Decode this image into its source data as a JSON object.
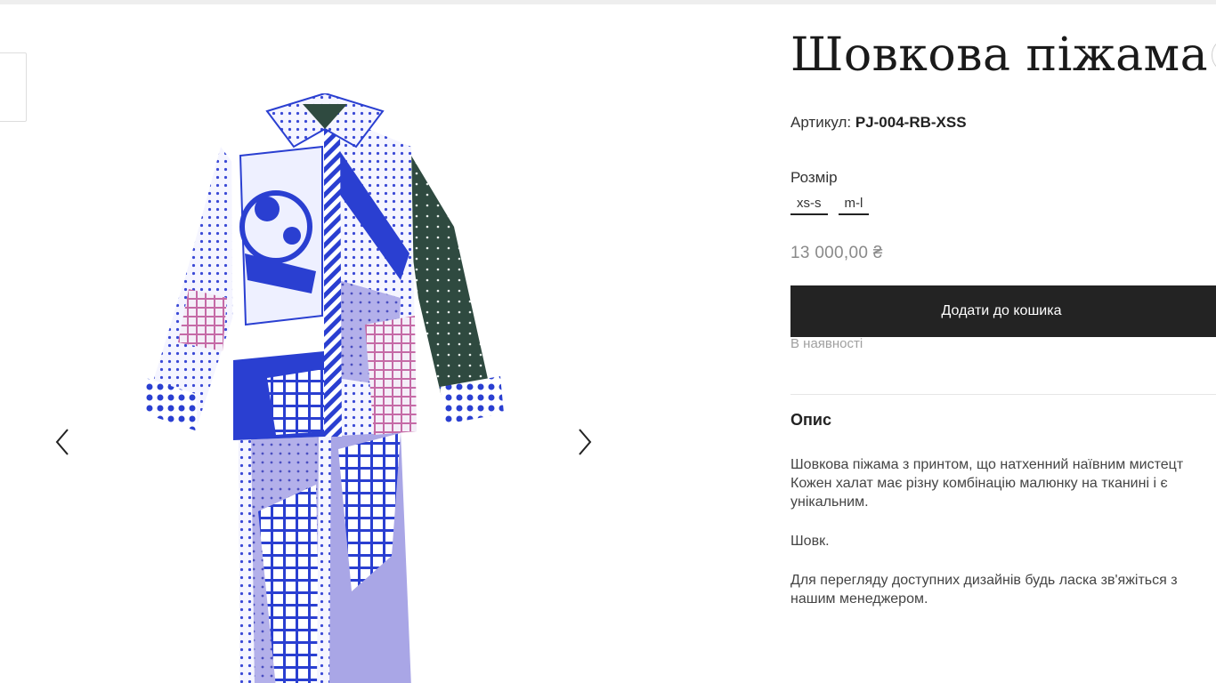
{
  "product": {
    "title": "Шовкова піжама",
    "sku_label": "Артикул:",
    "sku_value": "PJ-004-RB-XSS",
    "size_label": "Розмір",
    "sizes": [
      "xs-s",
      "m-l"
    ],
    "price": "13 000,00 ₴",
    "add_to_cart": "Додати до кошика",
    "stock_status": "В наявності"
  },
  "description": {
    "heading": "Опис",
    "paragraphs": [
      [
        "Шовкова піжама з принтом, що натхенний наївним мистецт",
        "Кожен халат має різну комбінацію малюнку на тканині і є",
        "унікальним."
      ],
      [
        "Шовк."
      ],
      [
        "Для перегляду доступних дизайнів  будь ласка зв'яжіться з",
        "нашим менеджером."
      ]
    ]
  },
  "gallery": {
    "prev_icon": "chevron-left-icon",
    "next_icon": "chevron-right-icon",
    "image": "silk pajama product photo"
  },
  "colors": {
    "button_bg": "#232323",
    "price": "#8a8a8a",
    "pattern_blue": "#2a3fd1",
    "pattern_lilac": "#a9a6e6",
    "pattern_green": "#2e4a3e"
  }
}
